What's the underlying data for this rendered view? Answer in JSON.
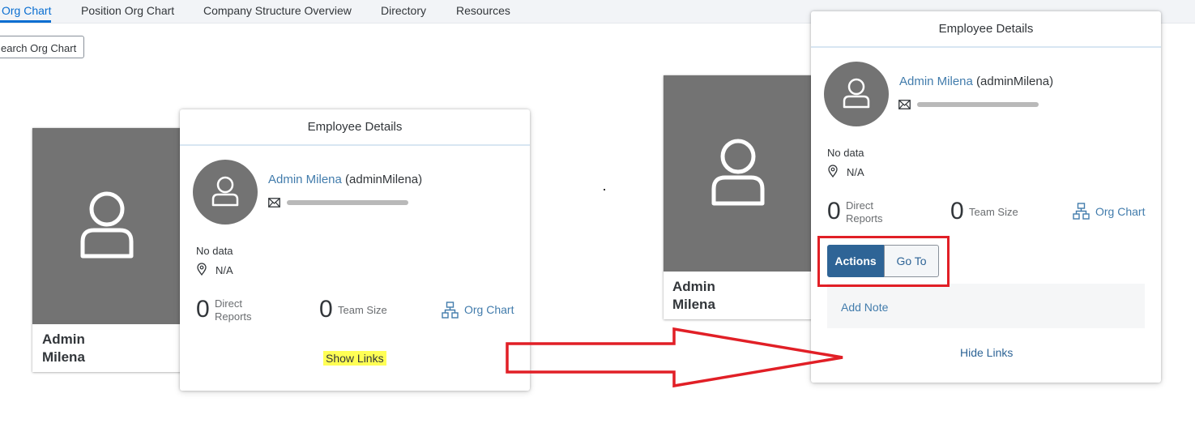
{
  "nav": {
    "tabs": [
      {
        "label": "Org Chart"
      },
      {
        "label": "Position Org Chart"
      },
      {
        "label": "Company Structure Overview"
      },
      {
        "label": "Directory"
      },
      {
        "label": "Resources"
      }
    ],
    "active_tab": "Org Chart"
  },
  "search_button": {
    "label": "earch Org Chart"
  },
  "org_nodes": [
    {
      "first": "Admin",
      "last": "Milena"
    },
    {
      "first": "Admin",
      "last": "Milena"
    }
  ],
  "popover_left": {
    "title": "Employee Details",
    "name": "Admin Milena",
    "username": "(adminMilena)",
    "no_data": "No data",
    "location": "N/A",
    "direct_reports_value": "0",
    "direct_reports_line1": "Direct",
    "direct_reports_line2": "Reports",
    "team_size_value": "0",
    "team_size_label": "Team Size",
    "org_chart_label": "Org Chart",
    "show_links_label": "Show Links"
  },
  "popover_right": {
    "title": "Employee Details",
    "name": "Admin Milena",
    "username": "(adminMilena)",
    "no_data": "No data",
    "location": "N/A",
    "direct_reports_value": "0",
    "direct_reports_line1": "Direct",
    "direct_reports_line2": "Reports",
    "team_size_value": "0",
    "team_size_label": "Team Size",
    "org_chart_label": "Org Chart",
    "actions_label": "Actions",
    "goto_label": "Go To",
    "add_note_label": "Add Note",
    "hide_links_label": "Hide Links"
  },
  "colors": {
    "accent": "#0a6ed1",
    "link": "#427cac",
    "photo_bg": "#737373",
    "annotation_red": "#e11f26",
    "highlight_yellow": "#ffff55",
    "actions_active": "#2e6496"
  },
  "icons": [
    "person-icon",
    "mail-icon",
    "location-pin-icon",
    "org-chart-icon",
    "right-arrow-annotation"
  ]
}
